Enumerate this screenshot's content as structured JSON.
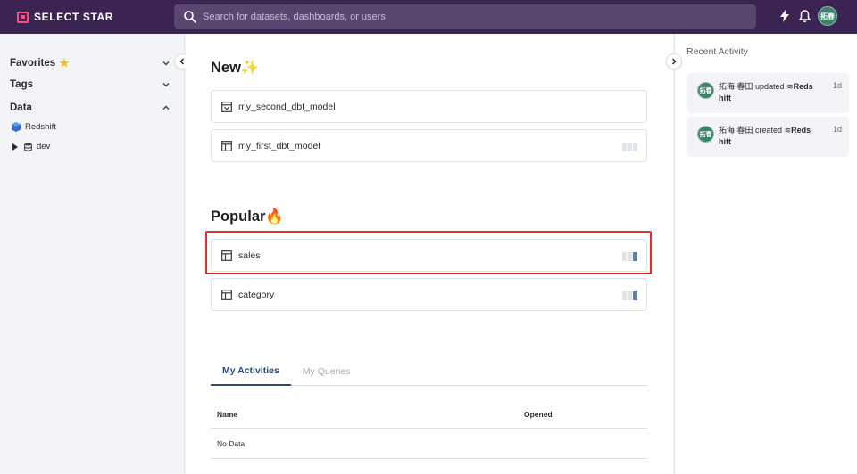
{
  "brand": {
    "name": "SELECT STAR",
    "accent": "#ff4d7e",
    "topbar_color": "#3b2352"
  },
  "search": {
    "placeholder": "Search for datasets, dashboards, or users"
  },
  "user": {
    "initials": "拓春"
  },
  "sidebar": {
    "favorites_label": "Favorites",
    "tags_label": "Tags",
    "data_label": "Data",
    "datasource": "Redshift",
    "database": "dev"
  },
  "main": {
    "new_title": "New✨",
    "new_items": [
      {
        "label": "my_second_dbt_model",
        "icon": "dbt-model-icon"
      },
      {
        "label": "my_first_dbt_model",
        "icon": "table-icon"
      }
    ],
    "popular_title": "Popular🔥",
    "popular_items": [
      {
        "label": "sales",
        "icon": "table-icon",
        "popularity_level": 1
      },
      {
        "label": "category",
        "icon": "table-icon",
        "popularity_level": 1
      }
    ],
    "tabs": [
      {
        "label": "My Activities",
        "active": true
      },
      {
        "label": "My Queries",
        "active": false
      }
    ],
    "table": {
      "columns": [
        "Name",
        "Opened"
      ],
      "empty_text": "No Data"
    }
  },
  "recent": {
    "title": "Recent Activity",
    "items": [
      {
        "avatar": "拓春",
        "user": "拓海 春田",
        "action": "updated",
        "target": "Reds hift",
        "time": "1d"
      },
      {
        "avatar": "拓春",
        "user": "拓海 春田",
        "action": "created",
        "target": "Reds hift",
        "time": "1d"
      }
    ]
  }
}
